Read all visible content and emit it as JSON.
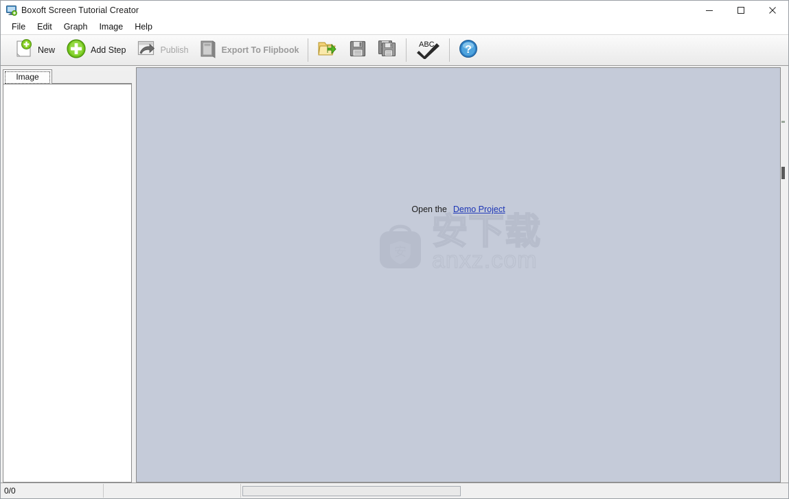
{
  "window": {
    "title": "Boxoft Screen Tutorial Creator",
    "icon": "screen-add-icon",
    "controls": [
      {
        "name": "minimize",
        "glyph": "—"
      },
      {
        "name": "maximize",
        "glyph": "□"
      },
      {
        "name": "close",
        "glyph": "✕"
      }
    ]
  },
  "menu": {
    "items": [
      {
        "label": "File"
      },
      {
        "label": "Edit"
      },
      {
        "label": "Graph"
      },
      {
        "label": "Image"
      },
      {
        "label": "Help"
      }
    ]
  },
  "toolbar": {
    "items": [
      {
        "label": "New",
        "icon": "new-page-icon",
        "enabled": true
      },
      {
        "label": "Add Step",
        "icon": "add-step-icon",
        "enabled": true
      },
      {
        "label": "Publish",
        "icon": "publish-icon",
        "enabled": false
      },
      {
        "label": "Export To Flipbook",
        "icon": "export-flipbook-icon",
        "enabled": false
      },
      {
        "label": "",
        "icon": "open-folder-icon",
        "enabled": true
      },
      {
        "label": "",
        "icon": "save-icon",
        "enabled": true
      },
      {
        "label": "",
        "icon": "save-as-icon",
        "enabled": true
      },
      {
        "label": "",
        "icon": "spell-check-icon",
        "enabled": true
      },
      {
        "label": "",
        "icon": "help-icon",
        "enabled": true
      }
    ]
  },
  "left_panel": {
    "tab_label": "Image",
    "list_items": []
  },
  "canvas": {
    "open_prefix": "Open the",
    "demo_link": "Demo Project",
    "watermark": {
      "cn_text": "安下载",
      "en_text": "anxz.com",
      "bag_glyph": "安"
    },
    "background_color": "#c5cbd9"
  },
  "statusbar": {
    "counter": "0/0",
    "second_cell": "",
    "progress_value": ""
  },
  "colors": {
    "canvas_bg": "#c5cbd9",
    "chrome_bg": "#f0f0f0",
    "link": "#1c35b5",
    "accent_green": "#5cb617"
  }
}
